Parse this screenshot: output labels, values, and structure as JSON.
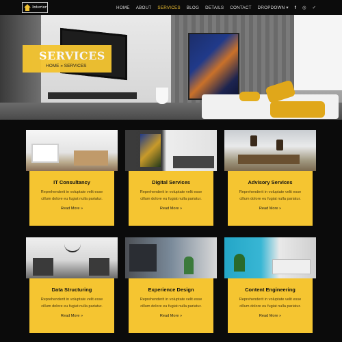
{
  "logo": {
    "text": "Interior"
  },
  "nav": {
    "items": [
      "HOME",
      "ABOUT",
      "SERVICES",
      "BLOG",
      "DETAILS",
      "CONTACT",
      "DROPDOWN"
    ],
    "active": "SERVICES",
    "dropdown_caret": "▾",
    "social": [
      "f",
      "◎",
      "✓"
    ]
  },
  "hero": {
    "title": "SERVICES",
    "breadcrumb": {
      "home": "HOME",
      "separator": "»",
      "current": "SERVICES"
    }
  },
  "services": [
    {
      "title": "IT Consultancy",
      "desc": "Reprehenderit in voluptate velit esse cillum dolore eu fugiat nulla pariatur.",
      "more": "Read More »"
    },
    {
      "title": "Digital Services",
      "desc": "Reprehenderit in voluptate velit esse cillum dolore eu fugiat nulla pariatur.",
      "more": "Read More »"
    },
    {
      "title": "Advisory Services",
      "desc": "Reprehenderit in voluptate velit esse cillum dolore eu fugiat nulla pariatur.",
      "more": "Read More »"
    },
    {
      "title": "Data Structuring",
      "desc": "Reprehenderit in voluptate velit esse cillum dolore eu fugiat nulla pariatur.",
      "more": "Read More »"
    },
    {
      "title": "Experience Design",
      "desc": "Reprehenderit in voluptate velit esse cillum dolore eu fugiat nulla pariatur.",
      "more": "Read More »"
    },
    {
      "title": "Content Engineering",
      "desc": "Reprehenderit in voluptate velit esse cillum dolore eu fugiat nulla pariatur.",
      "more": "Read More »"
    }
  ],
  "colors": {
    "accent": "#f3c431",
    "background": "#0b0b0b",
    "nav_active": "#f1c232"
  }
}
